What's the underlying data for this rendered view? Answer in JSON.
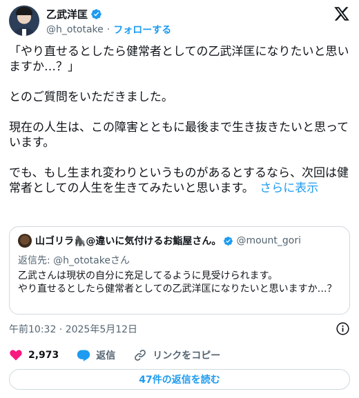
{
  "author": {
    "name": "乙武洋匡",
    "handle": "@h_ototake",
    "separator": "·",
    "follow_label": "フォローする"
  },
  "tweet": {
    "text": "「やり直せるとしたら健常者としての乙武洋匡になりたいと思いますか…？」\n\nとのご質問をいただきました。\n\n現在の人生は、この障害とともに最後まで生き抜きたいと思っています。\n\nでも、もし生まれ変わりというものがあるとするなら、次回は健常者としての人生を生きてみたいと思います。",
    "show_more": "さらに表示"
  },
  "quote": {
    "name": "山ゴリラ🦍@違いに気付けるお鮨屋さん。",
    "handle": "@mount_gori",
    "reply_to": "返信先: @h_ototakeさん",
    "text": "乙武さんは現状の自分に充足してるように見受けられます。\nやり直せるとしたら健常者としての乙武洋匡になりたいと思いますか…？"
  },
  "meta": {
    "timestamp": "午前10:32 · 2025年5月12日"
  },
  "actions": {
    "like_count": "2,973",
    "reply_label": "返信",
    "copy_link_label": "リンクをコピー"
  },
  "read_replies_label": "47件の返信を読む",
  "colors": {
    "accent": "#1d9bf0",
    "like": "#f91880",
    "secondary_text": "#536471",
    "border": "#cfd9de"
  },
  "icons": [
    "verified-badge-icon",
    "x-logo-icon",
    "info-icon",
    "heart-icon",
    "reply-icon",
    "link-icon"
  ]
}
